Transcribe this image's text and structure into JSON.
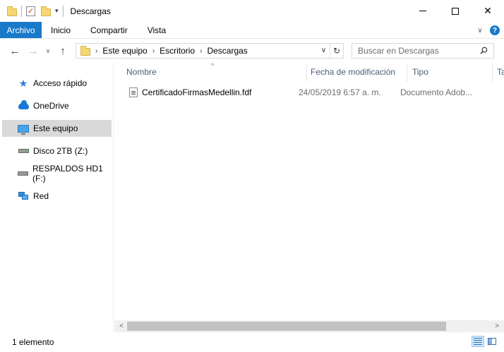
{
  "window": {
    "title": "Descargas",
    "minimize_icon": "minimize-icon",
    "maximize_icon": "maximize-icon",
    "close_glyph": "✕"
  },
  "ribbon": {
    "file_tab": "Archivo",
    "tabs": [
      "Inicio",
      "Compartir",
      "Vista"
    ],
    "expand_glyph": "∨",
    "help_glyph": "?"
  },
  "address": {
    "back_glyph": "←",
    "forward_glyph": "→",
    "recent_glyph": "∨",
    "up_glyph": "↑",
    "crumbs": [
      "Este equipo",
      "Escritorio",
      "Descargas"
    ],
    "crumb_separator": "›",
    "dropdown_glyph": "∨",
    "refresh_glyph": "↻"
  },
  "search": {
    "placeholder": "Buscar en Descargas"
  },
  "sidebar": {
    "items": [
      {
        "label": "Acceso rápido",
        "icon": "star-icon"
      },
      {
        "label": "OneDrive",
        "icon": "cloud-icon"
      },
      {
        "label": "Este equipo",
        "icon": "monitor-icon",
        "selected": true
      },
      {
        "label": "Disco 2TB (Z:)",
        "icon": "drive-icon"
      },
      {
        "label": "RESPALDOS HD1 (F:)",
        "icon": "drive-icon"
      },
      {
        "label": "Red",
        "icon": "network-icon"
      }
    ]
  },
  "columns": {
    "name": "Nombre",
    "date": "Fecha de modificación",
    "type": "Tipo",
    "size": "Ta",
    "sort_glyph": "^"
  },
  "files": [
    {
      "name": "CertificadoFirmasMedellin.fdf",
      "date": "24/05/2019 6:57 a. m.",
      "type": "Documento Adob..."
    }
  ],
  "scrollbar": {
    "left_glyph": "<",
    "right_glyph": ">"
  },
  "status": {
    "count": "1 elemento"
  },
  "colors": {
    "accent": "#1979ca",
    "selected_bg": "#d9d9d9",
    "header_text": "#4c607a",
    "secondary_text": "#6d6d6d"
  }
}
